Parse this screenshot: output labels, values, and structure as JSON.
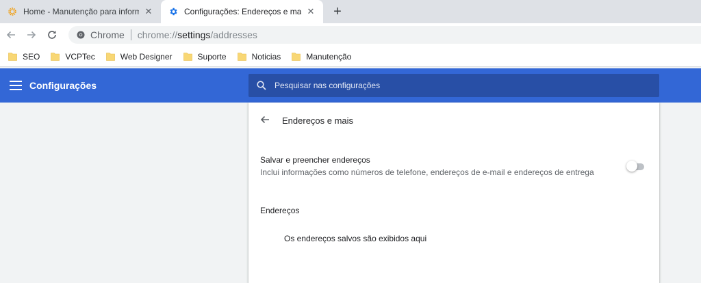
{
  "tabs": [
    {
      "title": "Home - Manutenção para inform",
      "favicon": "sun-gear-icon",
      "active": false
    },
    {
      "title": "Configurações: Endereços e mais",
      "favicon": "settings-gear-icon",
      "active": true
    }
  ],
  "toolbar": {
    "omnibox_chip": "Chrome",
    "url_scheme": "chrome://",
    "url_host": "settings",
    "url_path": "/addresses"
  },
  "bookmarks": [
    {
      "label": "SEO"
    },
    {
      "label": "VCPTec"
    },
    {
      "label": "Web Designer"
    },
    {
      "label": "Suporte"
    },
    {
      "label": "Noticias"
    },
    {
      "label": "Manutenção"
    }
  ],
  "header": {
    "title": "Configurações",
    "search_placeholder": "Pesquisar nas configurações"
  },
  "page": {
    "subpage_title": "Endereços e mais",
    "save_fill": {
      "label": "Salvar e preencher endereços",
      "description": "Inclui informações como números de telefone, endereços de e-mail e endereços de entrega",
      "enabled": false
    },
    "addresses_section": "Endereços",
    "empty_message": "Os endereços salvos são exibidos aqui"
  },
  "colors": {
    "header_blue": "#3367d6",
    "search_blue": "#284fa6",
    "favicon_orange": "#f29900",
    "settings_blue": "#1a73e8",
    "folder_yellow": "#f8d775"
  }
}
